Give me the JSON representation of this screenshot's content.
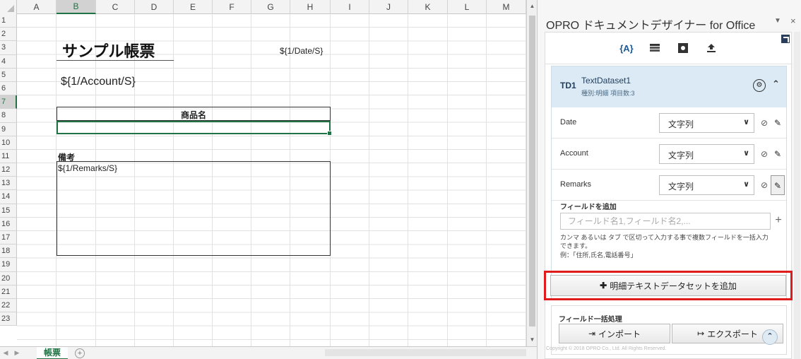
{
  "sheet": {
    "columns": [
      "A",
      "B",
      "C",
      "D",
      "E",
      "F",
      "G",
      "H",
      "I",
      "J",
      "K",
      "L",
      "M"
    ],
    "rows": [
      "1",
      "2",
      "3",
      "4",
      "5",
      "6",
      "7",
      "8",
      "9",
      "10",
      "11",
      "12",
      "13",
      "14",
      "15",
      "16",
      "17",
      "18",
      "19",
      "20",
      "21",
      "22",
      "23"
    ],
    "selected_column": "B",
    "selected_row": "7",
    "cells": {
      "title": "サンプル帳票",
      "date": "${1/Date/S}",
      "account": "${1/Account/S}",
      "product_header": "商品名",
      "remarks_label": "備考",
      "remarks_value": "${1/Remarks/S}"
    },
    "tab_label": "帳票",
    "add_sheet_glyph": "+"
  },
  "pane": {
    "title": "OPRO ドキュメントデザイナー for Office",
    "toolbar_icons": [
      "braces-icon",
      "table-icon",
      "settings-icon",
      "upload-icon"
    ],
    "dataset": {
      "id": "TD1",
      "name": "TextDataset1",
      "meta": "種別:明細  項目数:3",
      "fields": [
        {
          "name": "Date",
          "type": "文字列"
        },
        {
          "name": "Account",
          "type": "文字列"
        },
        {
          "name": "Remarks",
          "type": "文字列"
        }
      ]
    },
    "add_field": {
      "title": "フィールドを追加",
      "placeholder": "フィールド名1,フィールド名2,...",
      "help_line1": "カンマ あるいは タブ で区切って入力する事で複数フィールドを一括入力",
      "help_line2": "できます。",
      "example": "例：「住所,氏名,電話番号」"
    },
    "add_dataset_label": "明細テキストデータセットを追加",
    "bulk": {
      "title": "フィールド一括処理",
      "import_label": "インポート",
      "export_label": "エクスポート"
    },
    "copyright": "Copyright © 2018 OPRO Co., Ltd. All Rights Reserved.",
    "highlight_color": "#e01b1b"
  }
}
